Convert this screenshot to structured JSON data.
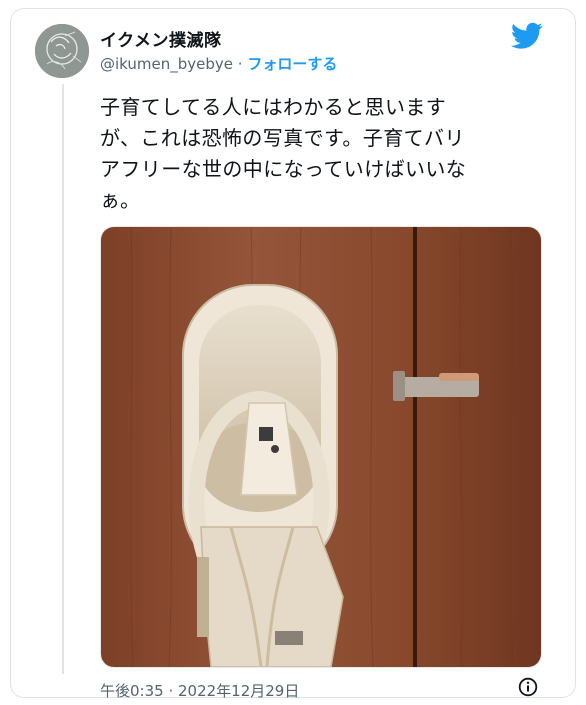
{
  "tweet": {
    "display_name": "イクメン撲滅隊",
    "handle": "@ikumen_byebye",
    "separator": "·",
    "follow_label": "フォローする",
    "text": "子育てしてる人にはわかると思います\nが、これは恐怖の写真です。子育てバリ\nアフリーな世の中になっていけばいいな\nぁ。",
    "timestamp": "午後0:35 · 2022年12月29日"
  },
  "icons": {
    "brand": "twitter-bird-icon",
    "info": "info-icon"
  },
  "colors": {
    "accent": "#1d9bf0",
    "secondary_text": "#536471",
    "door_wood": "#8a4a2e",
    "seat_beige": "#d9cbb3"
  }
}
